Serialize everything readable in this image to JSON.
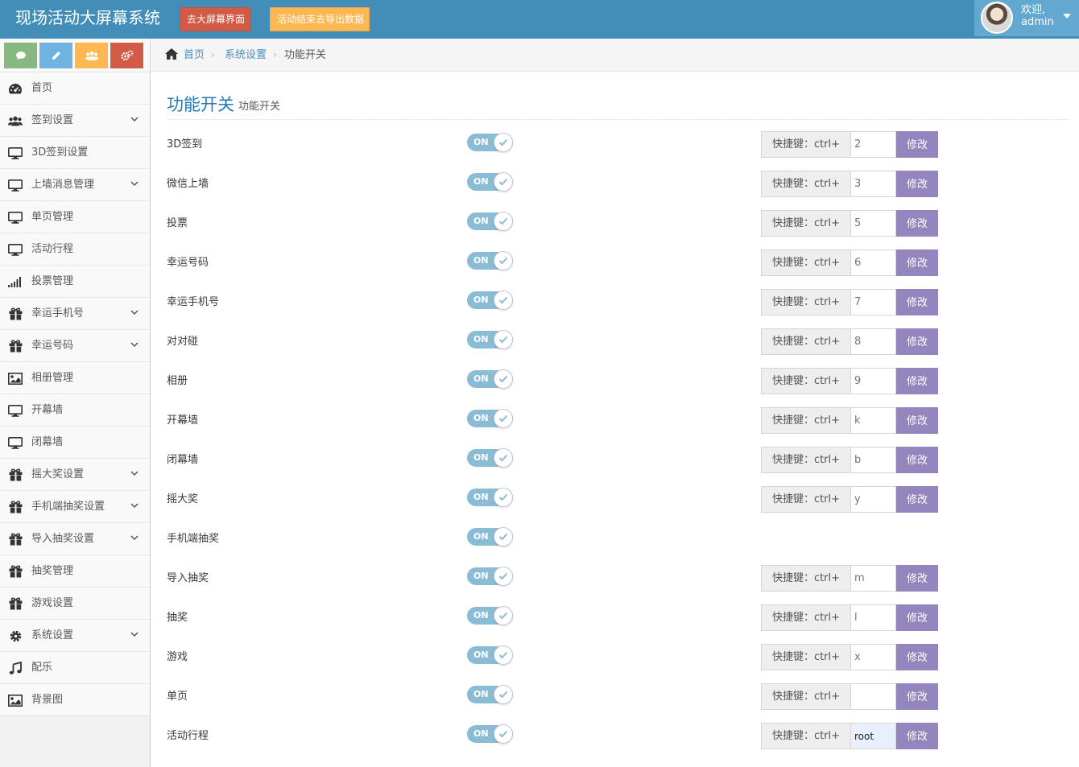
{
  "navbar": {
    "brand": "现场活动大屏幕系统",
    "btn_screen": "去大屏幕界面",
    "btn_export": "活动结束去导出数据",
    "user": {
      "greeting": "欢迎,",
      "name": "admin"
    }
  },
  "sidebar": {
    "shortcuts": [
      "comment-icon",
      "pencil-icon",
      "users-icon",
      "cogs-icon"
    ],
    "items": [
      {
        "label": "首页",
        "icon": "dashboard-icon",
        "expandable": false
      },
      {
        "label": "签到设置",
        "icon": "users-icon",
        "expandable": true
      },
      {
        "label": "3D签到设置",
        "icon": "desktop-icon",
        "expandable": false
      },
      {
        "label": "上墙消息管理",
        "icon": "desktop-icon",
        "expandable": true
      },
      {
        "label": "单页管理",
        "icon": "desktop-icon",
        "expandable": false
      },
      {
        "label": "活动行程",
        "icon": "desktop-icon",
        "expandable": false
      },
      {
        "label": "投票管理",
        "icon": "signal-icon",
        "expandable": false
      },
      {
        "label": "幸运手机号",
        "icon": "gift-icon",
        "expandable": true
      },
      {
        "label": "幸运号码",
        "icon": "gift-icon",
        "expandable": true
      },
      {
        "label": "相册管理",
        "icon": "picture-icon",
        "expandable": false
      },
      {
        "label": "开幕墙",
        "icon": "desktop-icon",
        "expandable": false
      },
      {
        "label": "闭幕墙",
        "icon": "desktop-icon",
        "expandable": false
      },
      {
        "label": "摇大奖设置",
        "icon": "gift-icon",
        "expandable": true
      },
      {
        "label": "手机端抽奖设置",
        "icon": "gift-icon",
        "expandable": true
      },
      {
        "label": "导入抽奖设置",
        "icon": "gift-icon",
        "expandable": true
      },
      {
        "label": "抽奖管理",
        "icon": "gift-icon",
        "expandable": false
      },
      {
        "label": "游戏设置",
        "icon": "gift-icon",
        "expandable": false
      },
      {
        "label": "系统设置",
        "icon": "gear-icon",
        "expandable": true
      },
      {
        "label": "配乐",
        "icon": "music-icon",
        "expandable": false
      },
      {
        "label": "背景图",
        "icon": "picture-icon",
        "expandable": false
      }
    ]
  },
  "breadcrumb": {
    "home": "首页",
    "parent": "系统设置",
    "current": "功能开关"
  },
  "page_header": {
    "title": "功能开关",
    "subtitle": "功能开关"
  },
  "shortcut_label": "快捷键：ctrl+",
  "modify_label": "修改",
  "toggle_label": "ON",
  "features": [
    {
      "name": "3D签到",
      "enabled": true,
      "has_shortcut": true,
      "key": "2",
      "input_value": ""
    },
    {
      "name": "微信上墙",
      "enabled": true,
      "has_shortcut": true,
      "key": "3",
      "input_value": ""
    },
    {
      "name": "投票",
      "enabled": true,
      "has_shortcut": true,
      "key": "5",
      "input_value": ""
    },
    {
      "name": "幸运号码",
      "enabled": true,
      "has_shortcut": true,
      "key": "6",
      "input_value": ""
    },
    {
      "name": "幸运手机号",
      "enabled": true,
      "has_shortcut": true,
      "key": "7",
      "input_value": ""
    },
    {
      "name": "对对碰",
      "enabled": true,
      "has_shortcut": true,
      "key": "8",
      "input_value": ""
    },
    {
      "name": "相册",
      "enabled": true,
      "has_shortcut": true,
      "key": "9",
      "input_value": ""
    },
    {
      "name": "开幕墙",
      "enabled": true,
      "has_shortcut": true,
      "key": "k",
      "input_value": ""
    },
    {
      "name": "闭幕墙",
      "enabled": true,
      "has_shortcut": true,
      "key": "b",
      "input_value": ""
    },
    {
      "name": "摇大奖",
      "enabled": true,
      "has_shortcut": true,
      "key": "y",
      "input_value": ""
    },
    {
      "name": "手机端抽奖",
      "enabled": true,
      "has_shortcut": false,
      "key": "",
      "input_value": ""
    },
    {
      "name": "导入抽奖",
      "enabled": true,
      "has_shortcut": true,
      "key": "m",
      "input_value": ""
    },
    {
      "name": "抽奖",
      "enabled": true,
      "has_shortcut": true,
      "key": "l",
      "input_value": ""
    },
    {
      "name": "游戏",
      "enabled": true,
      "has_shortcut": true,
      "key": "x",
      "input_value": ""
    },
    {
      "name": "单页",
      "enabled": true,
      "has_shortcut": true,
      "key": "",
      "input_value": ""
    },
    {
      "name": "活动行程",
      "enabled": true,
      "has_shortcut": true,
      "key": "",
      "input_value": "root"
    }
  ],
  "colors": {
    "navbar": "#438eb9",
    "btn_red": "#d15b47",
    "btn_orange": "#ffb752",
    "toggle_on": "#8bbcd6",
    "modify_btn": "#9585bf",
    "link": "#4c8fbd",
    "title": "#2679b5"
  }
}
